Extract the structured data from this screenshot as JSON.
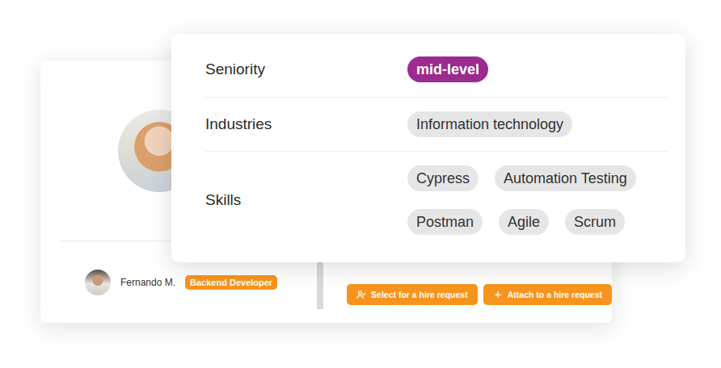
{
  "profile": {
    "rows": [
      {
        "label": "Seniority",
        "tags": [
          {
            "text": "mid-level",
            "color": "#9c2a8f"
          }
        ]
      },
      {
        "label": "Industries",
        "tags": [
          {
            "text": "Information technology",
            "color": "#e6e6e6"
          }
        ]
      },
      {
        "label": "Skills",
        "tags": [
          {
            "text": "Cypress",
            "color": "#e6e6e6"
          },
          {
            "text": "Automation Testing",
            "color": "#e6e6e6"
          },
          {
            "text": "Postman",
            "color": "#e6e6e6"
          },
          {
            "text": "Agile",
            "color": "#e6e6e6"
          },
          {
            "text": "Scrum",
            "color": "#e6e6e6"
          }
        ]
      }
    ]
  },
  "candidate": {
    "name": "Fernando M.",
    "role": "Backend Developer"
  },
  "actions": [
    {
      "label": "Select for a hire request"
    },
    {
      "label": "Attach to a hire request"
    }
  ]
}
